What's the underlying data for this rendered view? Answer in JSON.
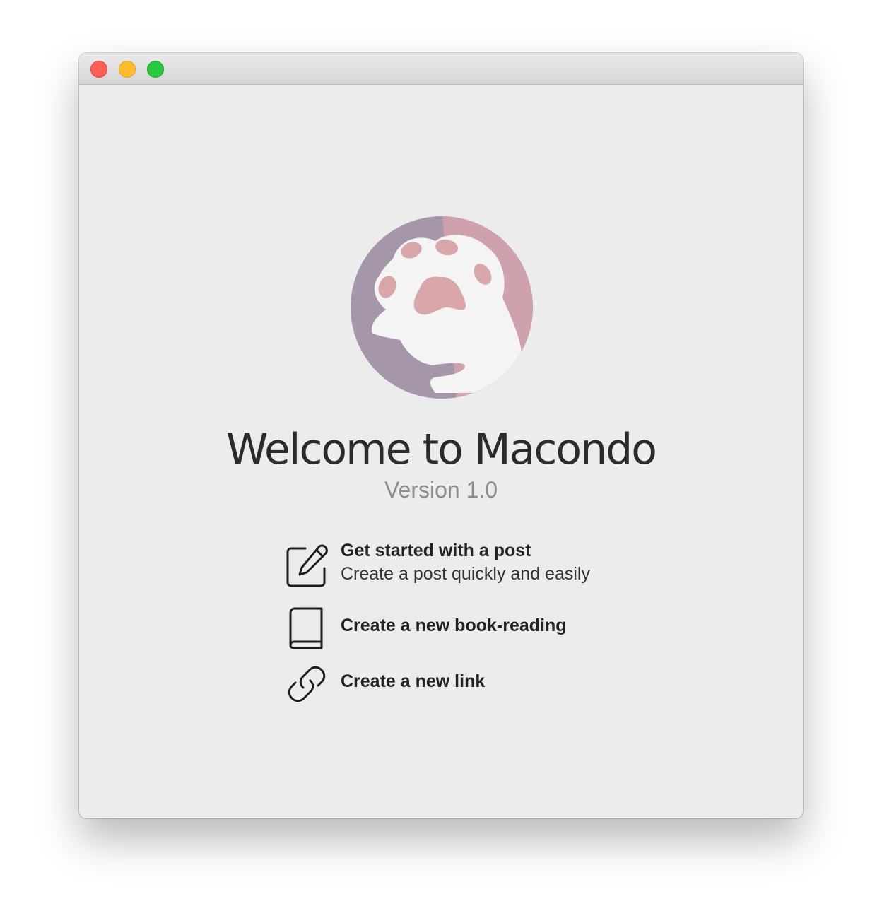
{
  "window": {
    "controls": {
      "close": "close-button",
      "minimize": "minimize-button",
      "zoom": "zoom-button"
    }
  },
  "colors": {
    "logo_purple": "#a596a9",
    "logo_pink": "#cfa1ac",
    "paw_white": "#f4f4f4",
    "pad_pink": "#d9a7aa",
    "title": "#2b2b2b",
    "version": "#8c8c8c"
  },
  "welcome": {
    "title": "Welcome to Macondo",
    "version": "Version 1.0"
  },
  "actions": [
    {
      "icon": "edit-icon",
      "label": "Get started with a post",
      "subtitle": "Create a post quickly and easily"
    },
    {
      "icon": "book-icon",
      "label": "Create a new book-reading"
    },
    {
      "icon": "link-icon",
      "label": "Create a new link"
    }
  ]
}
